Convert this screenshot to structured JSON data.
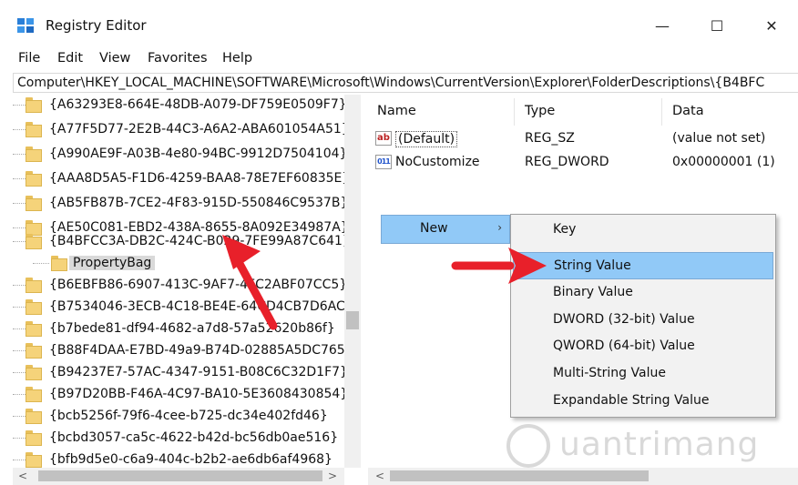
{
  "window": {
    "title": "Registry Editor",
    "minimize_glyph": "—",
    "maximize_glyph": "☐",
    "close_glyph": "✕"
  },
  "menu": [
    "File",
    "Edit",
    "View",
    "Favorites",
    "Help"
  ],
  "address": "Computer\\HKEY_LOCAL_MACHINE\\SOFTWARE\\Microsoft\\Windows\\CurrentVersion\\Explorer\\FolderDescriptions\\{B4BFC",
  "tree": {
    "items": [
      "{A63293E8-664E-48DB-A079-DF759E0509F7}",
      "{A77F5D77-2E2B-44C3-A6A2-ABA601054A51}",
      "{A990AE9F-A03B-4e80-94BC-9912D7504104}",
      "{AAA8D5A5-F1D6-4259-BAA8-78E7EF60835E}",
      "{AB5FB87B-7CE2-4F83-915D-550846C9537B}",
      "{AE50C081-EBD2-438A-8655-8A092E34987A}",
      "{B4BFCC3A-DB2C-424C-B029-7FE99A87C641}"
    ],
    "child": "PropertyBag",
    "items_after": [
      "{B6EBFB86-6907-413C-9AF7-4FC2ABF07CC5}",
      "{B7534046-3ECB-4C18-BE4E-64CD4CB7D6AC}",
      "{b7bede81-df94-4682-a7d8-57a52620b86f}",
      "{B88F4DAA-E7BD-49a9-B74D-02885A5DC765}",
      "{B94237E7-57AC-4347-9151-B08C6C32D1F7}",
      "{B97D20BB-F46A-4C97-BA10-5E3608430854}",
      "{bcb5256f-79f6-4cee-b725-dc34e402fd46}",
      "{bcbd3057-ca5c-4622-b42d-bc56db0ae516}",
      "{bfb9d5e0-c6a9-404c-b2b2-ae6db6af4968}"
    ]
  },
  "columns": {
    "name": "Name",
    "type": "Type",
    "data": "Data"
  },
  "values": [
    {
      "icon": "ab",
      "name": "(Default)",
      "type": "REG_SZ",
      "data": "(value not set)"
    },
    {
      "icon": "011",
      "name": "NoCustomize",
      "type": "REG_DWORD",
      "data": "0x00000001 (1)"
    }
  ],
  "context_menu": {
    "new_label": "New",
    "chevron": "›"
  },
  "submenu": [
    "Key",
    "String Value",
    "Binary Value",
    "DWORD (32-bit) Value",
    "QWORD (64-bit) Value",
    "Multi-String Value",
    "Expandable String Value"
  ],
  "watermark": "uantrimang",
  "colors": {
    "highlight": "#91c9f7",
    "arrow": "#e8202a",
    "folder": "#f5d37a"
  }
}
